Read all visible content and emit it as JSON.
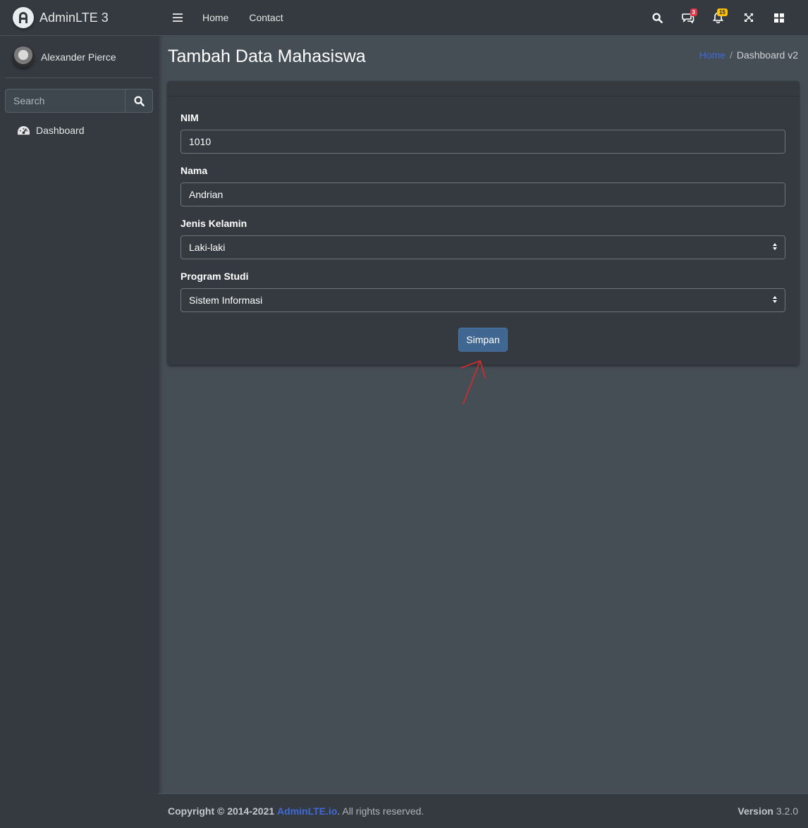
{
  "brand": {
    "name": "AdminLTE 3"
  },
  "user": {
    "name": "Alexander Pierce"
  },
  "sidebar": {
    "search_placeholder": "Search",
    "items": [
      {
        "label": "Dashboard",
        "icon": "tachometer-icon"
      }
    ]
  },
  "navbar": {
    "links": [
      "Home",
      "Contact"
    ],
    "messages_badge": "3",
    "notifications_badge": "15"
  },
  "header": {
    "title": "Tambah Data Mahasiswa",
    "breadcrumb": {
      "home": "Home",
      "separator": "/",
      "current": "Dashboard v2"
    }
  },
  "form": {
    "nim": {
      "label": "NIM",
      "value": "1010"
    },
    "nama": {
      "label": "Nama",
      "value": "Andrian"
    },
    "jenis_kelamin": {
      "label": "Jenis Kelamin",
      "value": "Laki-laki"
    },
    "program_studi": {
      "label": "Program Studi",
      "value": "Sistem Informasi"
    },
    "submit_label": "Simpan"
  },
  "footer": {
    "copyright": "Copyright © 2014-2021",
    "link": "AdminLTE.io",
    "suffix": ". All rights reserved.",
    "version_label": "Version",
    "version": "3.2.0"
  },
  "colors": {
    "accent": "#3f6ad8",
    "primary_button": "#3f6791",
    "danger": "#dc3545",
    "warning": "#ffc107",
    "annotation": "#d92b2b"
  }
}
